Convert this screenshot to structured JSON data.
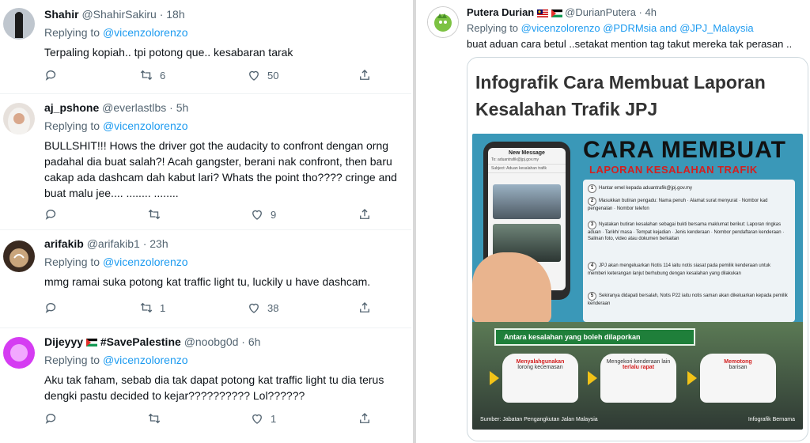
{
  "left_tweets": [
    {
      "name": "Shahir",
      "handle": "@ShahirSakiru · 18h",
      "replying_label": "Replying to",
      "replying_to": "@vicenzolorenzo",
      "text": "Terpaling kopiah.. tpi potong que.. kesabaran tarak",
      "retweets": "6",
      "likes": "50"
    },
    {
      "name": "aj_pshone",
      "handle": "@everlastlbs · 5h",
      "replying_label": "Replying to",
      "replying_to": "@vicenzolorenzo",
      "text": "BULLSHIT!!! Hows the driver got the audacity to confront dengan orng padahal dia buat salah?! Acah gangster, berani nak confront, then baru cakap ada dashcam dah kabut lari? Whats the point tho???? cringe and buat malu jee.... ........ ........",
      "retweets": "",
      "likes": "9"
    },
    {
      "name": "arifakib",
      "handle": "@arifakib1 · 23h",
      "replying_label": "Replying to",
      "replying_to": "@vicenzolorenzo",
      "text": "mmg ramai suka potong kat traffic light tu, luckily u have dashcam.",
      "retweets": "1",
      "likes": "38"
    },
    {
      "name": "Dijeyyy",
      "name_suffix": "#SavePalestine",
      "handle": "@noobg0d · 6h",
      "replying_label": "Replying to",
      "replying_to": "@vicenzolorenzo",
      "text": "Aku tak faham, sebab dia tak dapat potong kat traffic light tu dia terus dengki pastu decided to kejar?????????? Lol??????",
      "retweets": "",
      "likes": "1"
    }
  ],
  "right_tweet": {
    "name": "Putera Durian",
    "handle": "@DurianPutera · 4h",
    "replying_label": "Replying to",
    "replying_to": "@vicenzolorenzo @PDRMsia and @JPJ_Malaysia",
    "text": "buat aduan cara betul ..setakat mention tag takut mereka tak perasan .."
  },
  "infographic": {
    "title": "Infografik Cara Membuat Laporan Kesalahan Trafik JPJ",
    "big_heading": "CARA MEMBUAT",
    "sub_heading": "LAPORAN KESALAHAN TRAFIK",
    "phone_title": "New Message",
    "phone_to": "To: aduantrafik@jpj.gov.my",
    "phone_subject": "Subject: Aduan kesalahan trafik",
    "steps": [
      "Hantar emel kepada aduantrafik@jpj.gov.my",
      "Masukkan butiran pengadu: Nama penuh · Alamat surat menyurat · Nombor kad pengenalan · Nombor telefon",
      "Nyatakan butiran kesalahan sebagai bukti bersama maklumat berikut: Laporan ringkas aduan · Tarikh/ masa · Tempat kejadian · Jenis kenderaan · Nombor pendaftaran kenderaan · Salinan foto, video atau dokumen berkaitan",
      "JPJ akan mengeluarkan Notis 114 iaitu notis siasat pada pemilik kenderaan untuk memberi keterangan lanjut berhubung dengan kesalahan yang dilakukan",
      "Sekiranya didapati bersalah, Notis P22 iaitu notis saman akan dikeluarkan kepada pemilik kenderaan"
    ],
    "banner": "Antara kesalahan yang boleh dilaporkan",
    "offences": [
      {
        "top": "Menyalahgunakan",
        "bottom": "lorong kecemasan"
      },
      {
        "top": "Mengekori kenderaan lain",
        "bottom": "terlalu rapat"
      },
      {
        "top": "Memotong",
        "bottom": "barisan"
      }
    ],
    "source": "Sumber: Jabatan Pengangkutan Jalan Malaysia",
    "credit": "Infografik Bernama"
  },
  "colors": {
    "link": "#1d9bf0",
    "muted": "#536471",
    "infographic_bg": "#3a98b8",
    "red_text": "#d32020"
  },
  "icons": [
    "reply-icon",
    "retweet-icon",
    "like-icon",
    "share-icon",
    "palestine-flag-icon",
    "malaysia-flag-icon"
  ]
}
